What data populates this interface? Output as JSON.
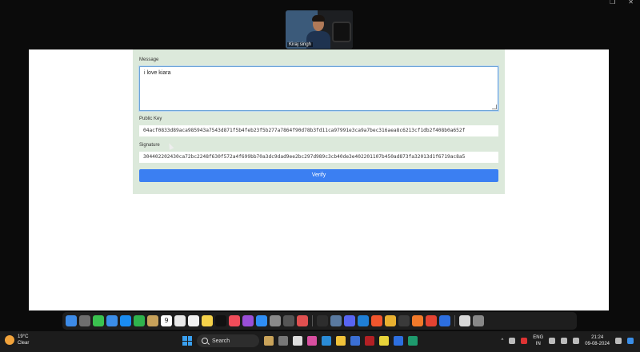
{
  "video": {
    "participant_name": "Kiraj singh"
  },
  "form": {
    "message_label": "Message",
    "message_value": "i love kiara",
    "public_key_label": "Public Key",
    "public_key_value": "04acf0833d89aca985943a7543d871f5b4feb23f5b277a7864f90d78b3fd11ca97991e3ca9a7bec316aea8c6213cf1db2f408b0a652f",
    "signature_label": "Signature",
    "signature_value": "304402202430ca72bc2248f630f572a4f699bb70a3dc9dad9ee2bc297d989c3cb40de3e402201107b450ad873fa32013d1f6719ac8a5",
    "verify_button": "Verify"
  },
  "dock": {
    "icons": [
      "finder-icon",
      "launchpad-icon",
      "messages-icon",
      "mail-icon",
      "safari-icon",
      "facetime-icon",
      "notes-icon",
      "calendar-icon",
      "photos-icon",
      "reminders-icon",
      "notes-yellow-icon",
      "appletv-icon",
      "music-icon",
      "podcasts-icon",
      "appstore-icon",
      "settings-icon",
      "system-icon",
      "preview-icon",
      "terminal-icon",
      "network-icon",
      "discord-icon",
      "vscode-icon",
      "brave-icon",
      "chrome-icon",
      "pinta-icon",
      "sublime-icon",
      "todoist-icon",
      "zoom-icon",
      "finder-window-icon",
      "trash-icon"
    ],
    "calendar_day": "9"
  },
  "taskbar": {
    "temperature": "19°C",
    "weather": "Clear",
    "search_label": "Search",
    "lang_top": "ENG",
    "lang_bottom": "IN",
    "time": "21:24",
    "date": "09-08-2024"
  },
  "colors": {
    "card_bg": "#dce9db",
    "button": "#3b7ff2",
    "textarea_border": "#6ba4d9"
  }
}
